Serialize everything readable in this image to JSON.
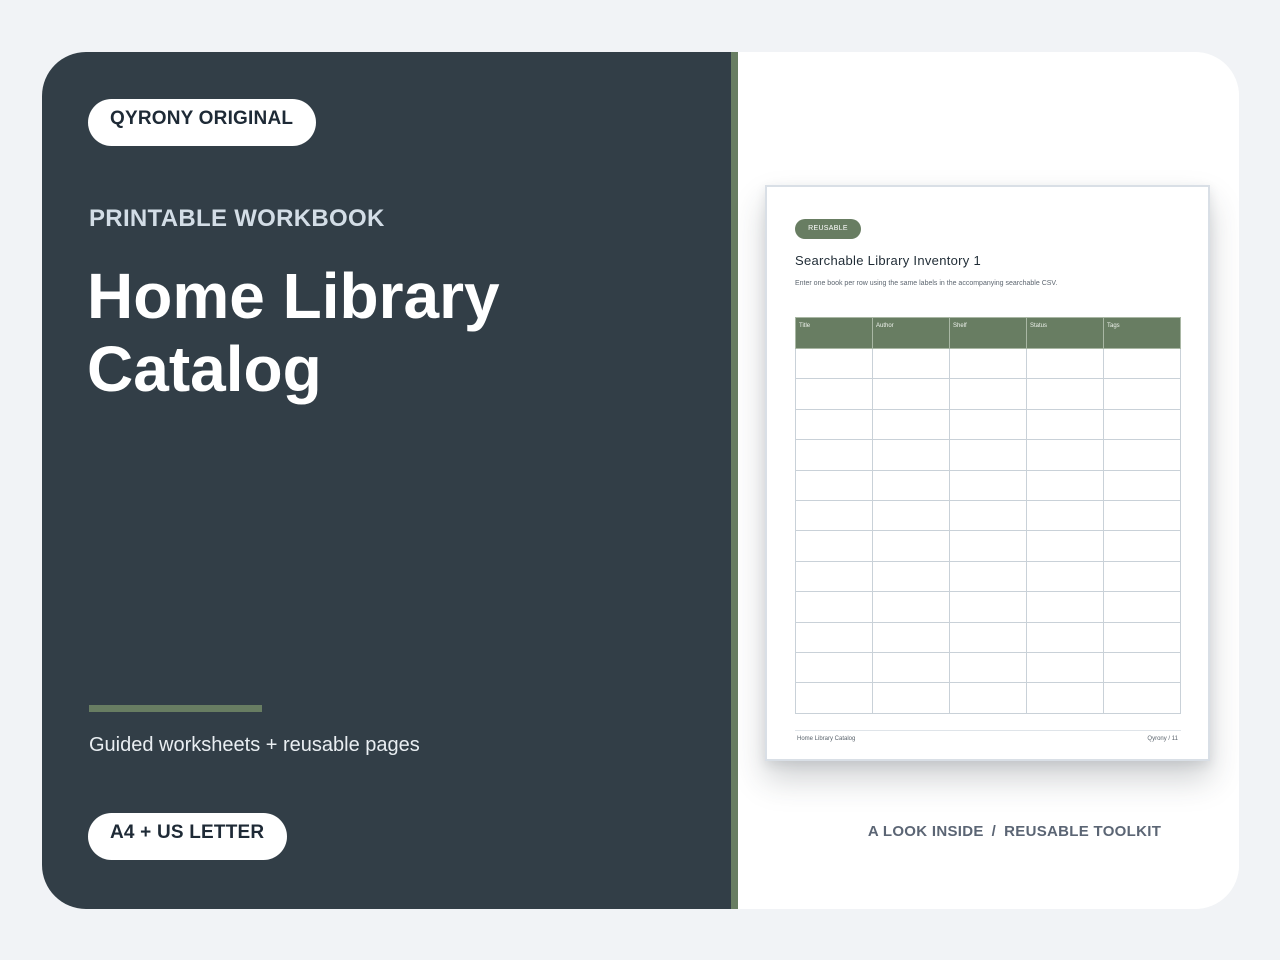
{
  "cover": {
    "brand_pill": "QYRONY ORIGINAL",
    "eyebrow": "PRINTABLE WORKBOOK",
    "title_line1": "Home Library",
    "title_line2": "Catalog",
    "subtitle": "Guided worksheets + reusable pages",
    "format_pill": "A4 + US LETTER"
  },
  "preview": {
    "tag": "REUSABLE",
    "title": "Searchable Library Inventory 1",
    "description": "Enter one book per row using the same labels in the accompanying searchable CSV.",
    "columns": [
      "Title",
      "Author",
      "Shelf",
      "Status",
      "Tags"
    ],
    "empty_rows": 12,
    "footer_left": "Home Library Catalog",
    "footer_right": "Qyrony / 11"
  },
  "caption": {
    "left": "A LOOK INSIDE",
    "separator": "/",
    "right": "REUSABLE TOOLKIT"
  },
  "colors": {
    "panel": "#323e47",
    "accent": "#687d62",
    "background": "#f1f3f6"
  }
}
